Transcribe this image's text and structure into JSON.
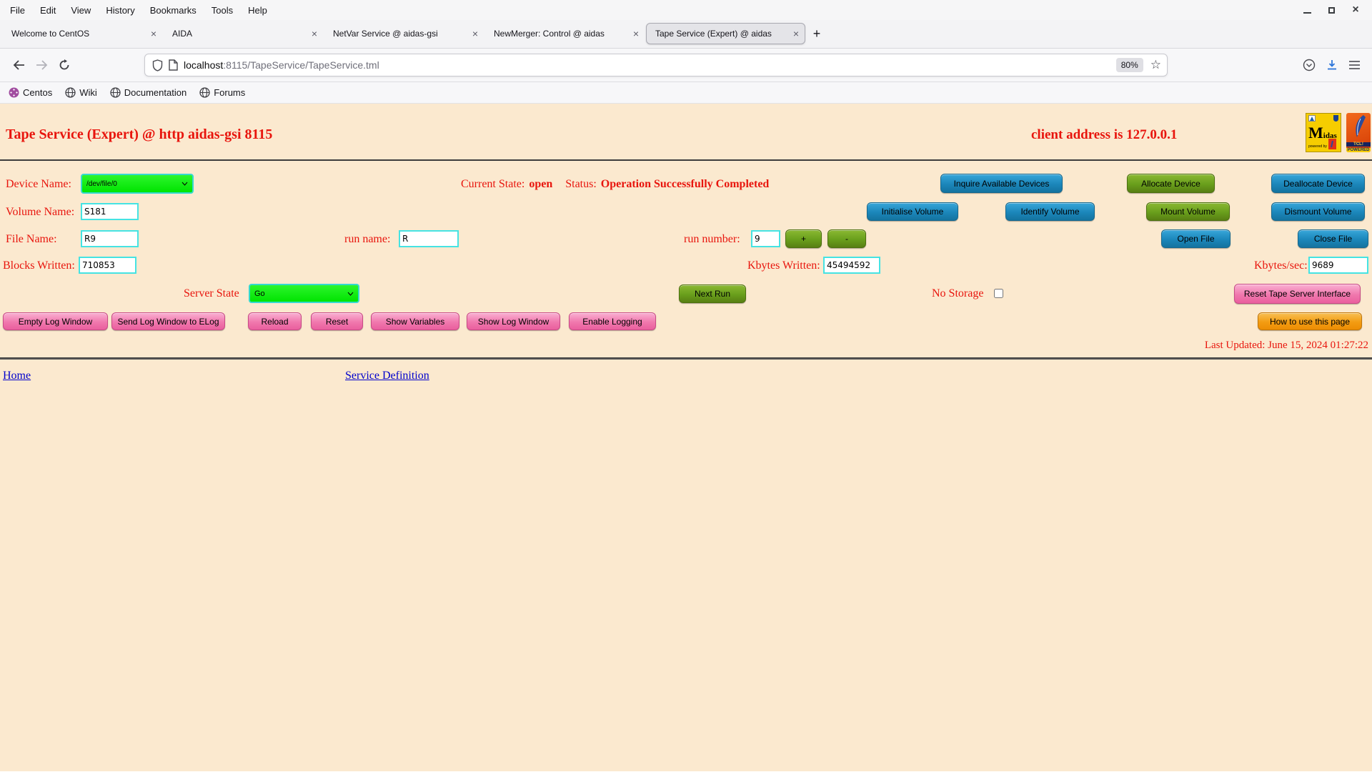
{
  "colors": {
    "page_bg": "#fbe9cf",
    "red_text": "#e8150d",
    "blue_button": "#1b86ba",
    "green_button": "#699f1c",
    "pink_button": "#f078ad",
    "orange_button": "#f39c12",
    "select_green": "#00e400",
    "input_border": "#45e3e3",
    "link_blue": "#0000cc",
    "download_blue": "#0060df"
  },
  "browser": {
    "menu": [
      "File",
      "Edit",
      "View",
      "History",
      "Bookmarks",
      "Tools",
      "Help"
    ],
    "tabs": [
      {
        "label": "Welcome to CentOS"
      },
      {
        "label": "AIDA"
      },
      {
        "label": "NetVar Service @ aidas-gsi"
      },
      {
        "label": "NewMerger: Control @ aidas"
      },
      {
        "label": "Tape Service (Expert) @ aidas"
      }
    ],
    "tab_close_glyph": "×",
    "new_tab_label": "+",
    "nav": {
      "url_host": "localhost",
      "url_rest": ":8115/TapeService/TapeService.tml",
      "zoom_badge": "80%"
    },
    "bookmarks": [
      {
        "label": "Centos"
      },
      {
        "label": "Wiki"
      },
      {
        "label": "Documentation"
      },
      {
        "label": "Forums"
      }
    ]
  },
  "page": {
    "title": "Tape Service (Expert) @ http aidas-gsi 8115",
    "client_address": "client address is 127.0.0.1",
    "logos": {
      "midas_text": "Midas",
      "midas_sub": "powered by",
      "tcl_text": "TCL!",
      "tcl_sub": "POWERED"
    },
    "device": {
      "label": "Device Name:",
      "value": "/dev/file/0"
    },
    "state": {
      "current_label": "Current State:",
      "current_value": "open",
      "status_label": "Status:",
      "status_value": "Operation Successfully Completed"
    },
    "volume": {
      "label": "Volume Name:",
      "value": "S181"
    },
    "file": {
      "label": "File Name:",
      "value": "R9"
    },
    "run_name": {
      "label": "run name:",
      "value": "R"
    },
    "run_number": {
      "label": "run number:",
      "value": "9"
    },
    "blocks": {
      "label": "Blocks Written:",
      "value": "710853"
    },
    "kbytes": {
      "label": "Kbytes Written:",
      "value": "45494592"
    },
    "kbytes_sec": {
      "label": "Kbytes/sec:",
      "value": "9689"
    },
    "server_state": {
      "label": "Server State",
      "value": "Go"
    },
    "no_storage": {
      "label": "No Storage"
    },
    "buttons": {
      "inquire": "Inquire Available Devices",
      "allocate": "Allocate Device",
      "deallocate": "Deallocate Device",
      "initialise": "Initialise Volume",
      "identify": "Identify Volume",
      "mount": "Mount Volume",
      "dismount": "Dismount Volume",
      "open_file": "Open File",
      "close_file": "Close File",
      "plus": "+",
      "minus": "-",
      "next_run": "Next Run",
      "reset_tape": "Reset Tape Server Interface",
      "empty_log": "Empty Log Window",
      "send_elog": "Send Log Window to ELog",
      "reload": "Reload",
      "reset": "Reset",
      "show_variables": "Show Variables",
      "show_log": "Show Log Window",
      "enable_logging": "Enable Logging",
      "how_to": "How to use this page"
    },
    "footer": {
      "last_updated": "Last Updated: June 15, 2024 01:27:22",
      "home": "Home",
      "service_definition": "Service Definition"
    }
  }
}
